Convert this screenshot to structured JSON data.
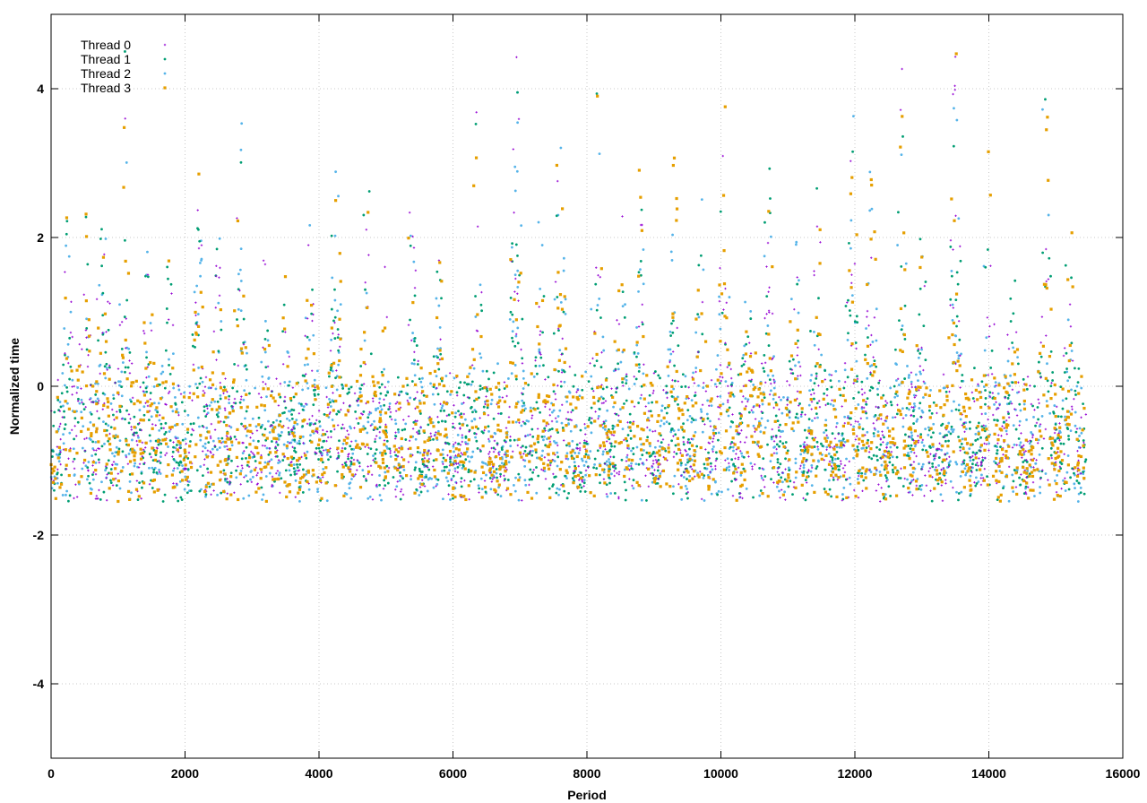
{
  "chart_data": {
    "type": "scatter",
    "xlabel": "Period",
    "ylabel": "Normalized time",
    "xlim": [
      0,
      16000
    ],
    "ylim": [
      -5,
      5
    ],
    "x_ticks": [
      "0",
      "2000",
      "4000",
      "6000",
      "8000",
      "10000",
      "12000",
      "14000",
      "16000"
    ],
    "y_ticks": [
      "-4",
      "-2",
      "0",
      "2",
      "4"
    ],
    "grid": true,
    "legend_position": "top-left",
    "series": [
      {
        "name": "Thread 0",
        "color": "#9400d3",
        "marker": "plus"
      },
      {
        "name": "Thread 1",
        "color": "#009e73",
        "marker": "dot"
      },
      {
        "name": "Thread 2",
        "color": "#56b4e9",
        "marker": "dot"
      },
      {
        "name": "Thread 3",
        "color": "#e69f00",
        "marker": "square"
      }
    ],
    "x_extent": [
      0,
      15450
    ],
    "baseline_range": [
      -1.5,
      0.3
    ],
    "bursts": [
      {
        "x": 250,
        "peak": 2.2
      },
      {
        "x": 500,
        "peak": 2.5
      },
      {
        "x": 780,
        "peak": 3.0
      },
      {
        "x": 1100,
        "peak": 3.6
      },
      {
        "x": 1450,
        "peak": 1.8
      },
      {
        "x": 1750,
        "peak": 2.1
      },
      {
        "x": 2200,
        "peak": 2.8
      },
      {
        "x": 2500,
        "peak": 2.0
      },
      {
        "x": 2820,
        "peak": 3.4
      },
      {
        "x": 3200,
        "peak": 1.6
      },
      {
        "x": 3500,
        "peak": 1.0
      },
      {
        "x": 3850,
        "peak": 2.2
      },
      {
        "x": 4250,
        "peak": 3.5
      },
      {
        "x": 4700,
        "peak": 3.0
      },
      {
        "x": 5000,
        "peak": 0.8
      },
      {
        "x": 5400,
        "peak": 2.4
      },
      {
        "x": 5800,
        "peak": 2.0
      },
      {
        "x": 6350,
        "peak": 3.6
      },
      {
        "x": 6950,
        "peak": 4.5
      },
      {
        "x": 7300,
        "peak": 2.5
      },
      {
        "x": 7600,
        "peak": 3.5
      },
      {
        "x": 8150,
        "peak": 4.0
      },
      {
        "x": 8500,
        "peak": 2.5
      },
      {
        "x": 8800,
        "peak": 3.0
      },
      {
        "x": 9300,
        "peak": 3.5
      },
      {
        "x": 9700,
        "peak": 2.8
      },
      {
        "x": 10050,
        "peak": 3.5
      },
      {
        "x": 10400,
        "peak": 2.5
      },
      {
        "x": 10700,
        "peak": 3.0
      },
      {
        "x": 11100,
        "peak": 2.0
      },
      {
        "x": 11450,
        "peak": 2.8
      },
      {
        "x": 11950,
        "peak": 4.0
      },
      {
        "x": 12250,
        "peak": 3.0
      },
      {
        "x": 12700,
        "peak": 3.5
      },
      {
        "x": 13000,
        "peak": 2.5
      },
      {
        "x": 13500,
        "peak": 4.5
      },
      {
        "x": 14000,
        "peak": 2.8
      },
      {
        "x": 14350,
        "peak": 2.0
      },
      {
        "x": 14850,
        "peak": 4.5
      },
      {
        "x": 15200,
        "peak": 2.5
      }
    ]
  }
}
